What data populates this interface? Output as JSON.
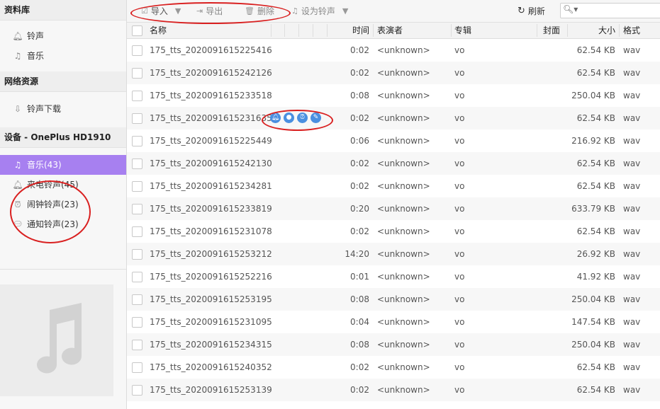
{
  "sidebar": {
    "library_title": "资料库",
    "library_items": [
      {
        "label": "铃声",
        "icon": "bell-icon"
      },
      {
        "label": "音乐",
        "icon": "music-note-icon"
      }
    ],
    "network_title": "网络资源",
    "network_items": [
      {
        "label": "铃声下载",
        "icon": "download-icon"
      }
    ],
    "device_title": "设备 - OnePlus HD1910",
    "device_items": [
      {
        "label": "音乐(43)",
        "icon": "music-note-icon",
        "active": true
      },
      {
        "label": "来电铃声(45)",
        "icon": "bell-icon"
      },
      {
        "label": "闹钟铃声(23)",
        "icon": "alarm-clock-icon"
      },
      {
        "label": "通知铃声(23)",
        "icon": "chat-bubble-icon"
      }
    ]
  },
  "toolbar": {
    "import_label": "导入",
    "export_label": "导出",
    "delete_label": "删除",
    "set_ringtone_label": "设为铃声",
    "refresh_label": "刷新",
    "search_placeholder": ""
  },
  "table": {
    "columns": [
      "名称",
      "时间",
      "表演者",
      "专辑",
      "封面",
      "大小",
      "格式"
    ],
    "rows": [
      {
        "name": "175_tts_2020091615225416",
        "time": "0:02",
        "artist": "<unknown>",
        "album": "vo",
        "size": "62.54 KB",
        "format": "wav"
      },
      {
        "name": "175_tts_2020091615242126",
        "time": "0:02",
        "artist": "<unknown>",
        "album": "vo",
        "size": "62.54 KB",
        "format": "wav"
      },
      {
        "name": "175_tts_2020091615233518",
        "time": "0:08",
        "artist": "<unknown>",
        "album": "vo",
        "size": "250.04 KB",
        "format": "wav"
      },
      {
        "name": "175_tts_2020091615231635",
        "time": "0:02",
        "artist": "<unknown>",
        "album": "vo",
        "size": "62.54 KB",
        "format": "wav"
      },
      {
        "name": "175_tts_2020091615225449",
        "time": "0:06",
        "artist": "<unknown>",
        "album": "vo",
        "size": "216.92 KB",
        "format": "wav"
      },
      {
        "name": "175_tts_2020091615242130",
        "time": "0:02",
        "artist": "<unknown>",
        "album": "vo",
        "size": "62.54 KB",
        "format": "wav"
      },
      {
        "name": "175_tts_2020091615234281",
        "time": "0:02",
        "artist": "<unknown>",
        "album": "vo",
        "size": "62.54 KB",
        "format": "wav"
      },
      {
        "name": "175_tts_2020091615233819",
        "time": "0:20",
        "artist": "<unknown>",
        "album": "vo",
        "size": "633.79 KB",
        "format": "wav"
      },
      {
        "name": "175_tts_2020091615231078",
        "time": "0:02",
        "artist": "<unknown>",
        "album": "vo",
        "size": "62.54 KB",
        "format": "wav"
      },
      {
        "name": "175_tts_2020091615253212",
        "time": "14:20",
        "artist": "<unknown>",
        "album": "vo",
        "size": "26.92 KB",
        "format": "wav"
      },
      {
        "name": "175_tts_2020091615252216",
        "time": "0:01",
        "artist": "<unknown>",
        "album": "vo",
        "size": "41.92 KB",
        "format": "wav"
      },
      {
        "name": "175_tts_2020091615253195",
        "time": "0:08",
        "artist": "<unknown>",
        "album": "vo",
        "size": "250.04 KB",
        "format": "wav"
      },
      {
        "name": "175_tts_2020091615231095",
        "time": "0:04",
        "artist": "<unknown>",
        "album": "vo",
        "size": "147.54 KB",
        "format": "wav"
      },
      {
        "name": "175_tts_2020091615234315",
        "time": "0:08",
        "artist": "<unknown>",
        "album": "vo",
        "size": "250.04 KB",
        "format": "wav"
      },
      {
        "name": "175_tts_2020091615240352",
        "time": "0:02",
        "artist": "<unknown>",
        "album": "vo",
        "size": "62.54 KB",
        "format": "wav"
      },
      {
        "name": "175_tts_2020091615253139",
        "time": "0:02",
        "artist": "<unknown>",
        "album": "vo",
        "size": "62.54 KB",
        "format": "wav"
      }
    ],
    "hover_row_actions": [
      "bell-icon",
      "chat-bubble-icon",
      "alarm-clock-icon",
      "edit-icon"
    ]
  },
  "colors": {
    "accent": "#a780f0",
    "annotation": "#d92020",
    "action_icon": "#4a8fe0"
  }
}
